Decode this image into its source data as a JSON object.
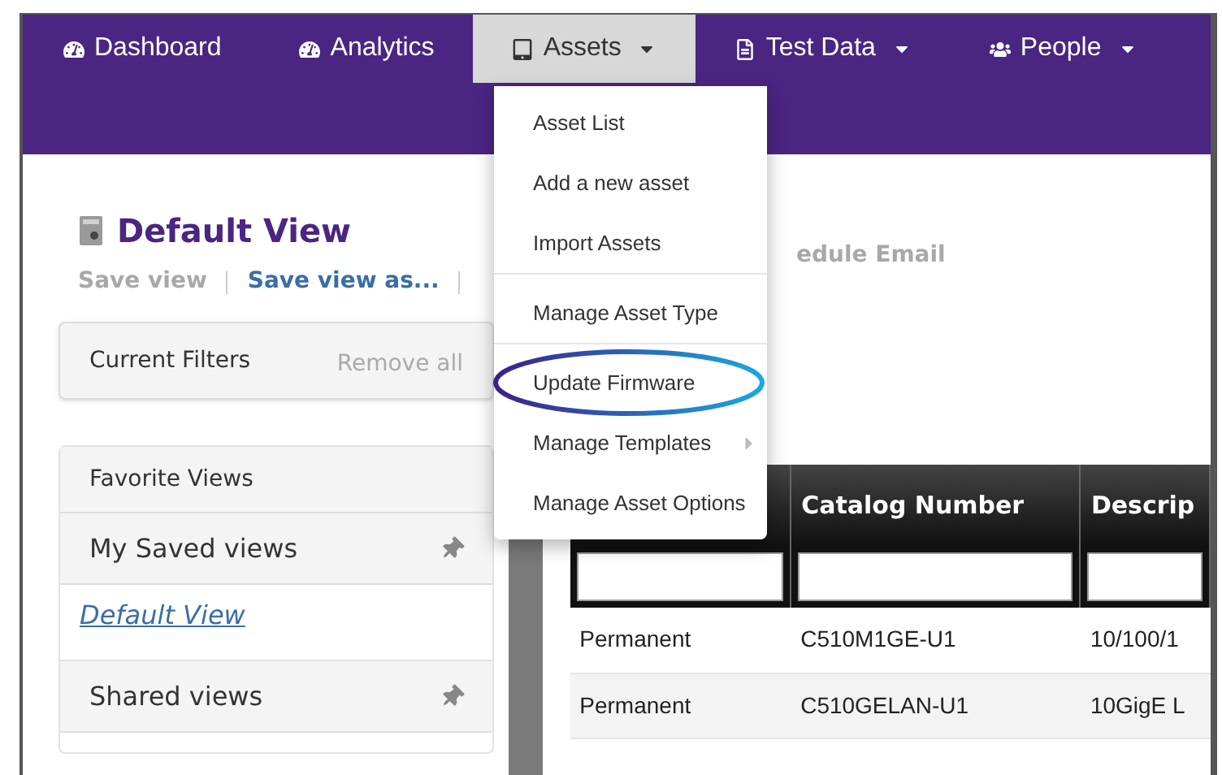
{
  "nav": {
    "items": [
      {
        "label": "Dashboard",
        "kind": "gauge",
        "selected": false,
        "dropdown": false
      },
      {
        "label": "Analytics",
        "kind": "gauge",
        "selected": false,
        "dropdown": false
      },
      {
        "label": "Assets",
        "kind": "tablet",
        "selected": true,
        "dropdown": true
      },
      {
        "label": "Test Data",
        "kind": "file",
        "selected": false,
        "dropdown": true
      },
      {
        "label": "People",
        "kind": "users",
        "selected": false,
        "dropdown": true
      }
    ]
  },
  "dropdown": {
    "groups": [
      [
        {
          "label": "Asset List",
          "submenu": false
        },
        {
          "label": "Add a new asset",
          "submenu": false
        },
        {
          "label": "Import Assets",
          "submenu": false
        }
      ],
      [
        {
          "label": "Manage Asset Type",
          "submenu": false
        }
      ],
      [
        {
          "label": "Update Firmware",
          "submenu": false,
          "highlighted": true
        },
        {
          "label": "Manage Templates",
          "submenu": true
        },
        {
          "label": "Manage Asset Options",
          "submenu": false
        }
      ]
    ]
  },
  "view": {
    "title": "Default View",
    "actions": [
      {
        "label": "Save view",
        "disabled": true
      },
      {
        "label": "Save view as...",
        "disabled": false
      }
    ],
    "partial_action": "edule Email"
  },
  "filters": {
    "title": "Current Filters",
    "remove": "Remove all"
  },
  "views_panel": {
    "favorite": "Favorite Views",
    "sections": [
      {
        "title": "My Saved views",
        "links": [
          "Default View"
        ]
      },
      {
        "title": "Shared views"
      }
    ]
  },
  "table": {
    "columns": [
      "",
      "Catalog Number",
      "Descrip"
    ],
    "rows": [
      [
        "Permanent",
        "C510M1GE-U1",
        "10/100/1"
      ],
      [
        "Permanent",
        "C510GELAN-U1",
        "10GigE L"
      ]
    ]
  }
}
